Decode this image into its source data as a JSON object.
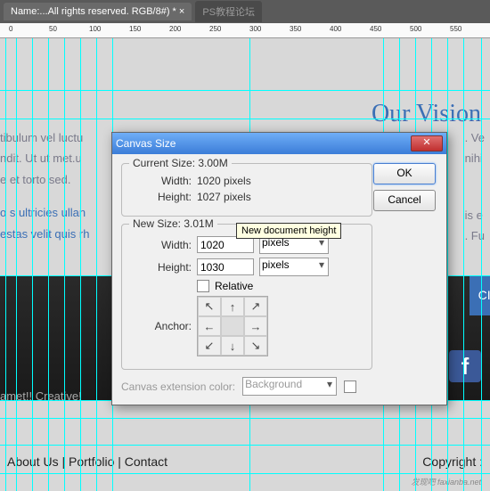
{
  "tabs": {
    "active": "Name:...All rights reserved. RGB/8#) * ×",
    "inactive": "PS教程论坛"
  },
  "ruler": [
    "0",
    "50",
    "100",
    "150",
    "200",
    "250",
    "300",
    "350",
    "400",
    "450",
    "500",
    "550"
  ],
  "bg": {
    "vision": "Our Vision",
    "p1": "tibulum vel luctu",
    "p2": "ndit. Ut ut met.u",
    "p3": "e et torto sed.",
    "p4": "o s ultricies ullan",
    "p5": "estas velit quis rh",
    "r1": ". Ve",
    "r2": "nihi",
    "r3": "is e",
    "r4": ". Fu",
    "social": "CIA",
    "fb": "f",
    "tagline": "amet!! Creative!",
    "footer_left": "About Us  |  Portfolio  |  Contact",
    "footer_right": "Copyright :",
    "wm": "发现吧\nfaxianba.net"
  },
  "dialog": {
    "title": "Canvas Size",
    "ok": "OK",
    "cancel": "Cancel",
    "current": {
      "legend": "Current Size: 3.00M",
      "width_label": "Width:",
      "width_value": "1020 pixels",
      "height_label": "Height:",
      "height_value": "1027 pixels"
    },
    "newsize": {
      "legend": "New Size: 3.01M",
      "width_label": "Width:",
      "width_value": "1020",
      "width_unit": "pixels",
      "height_label": "Height:",
      "height_value": "1030",
      "height_unit": "pixels",
      "relative": "Relative",
      "anchor": "Anchor:",
      "tooltip": "New document height"
    },
    "ext": {
      "label": "Canvas extension color:",
      "value": "Background"
    },
    "arrows": [
      "↖",
      "↑",
      "↗",
      "←",
      "",
      "→",
      "↙",
      "↓",
      "↘"
    ]
  }
}
